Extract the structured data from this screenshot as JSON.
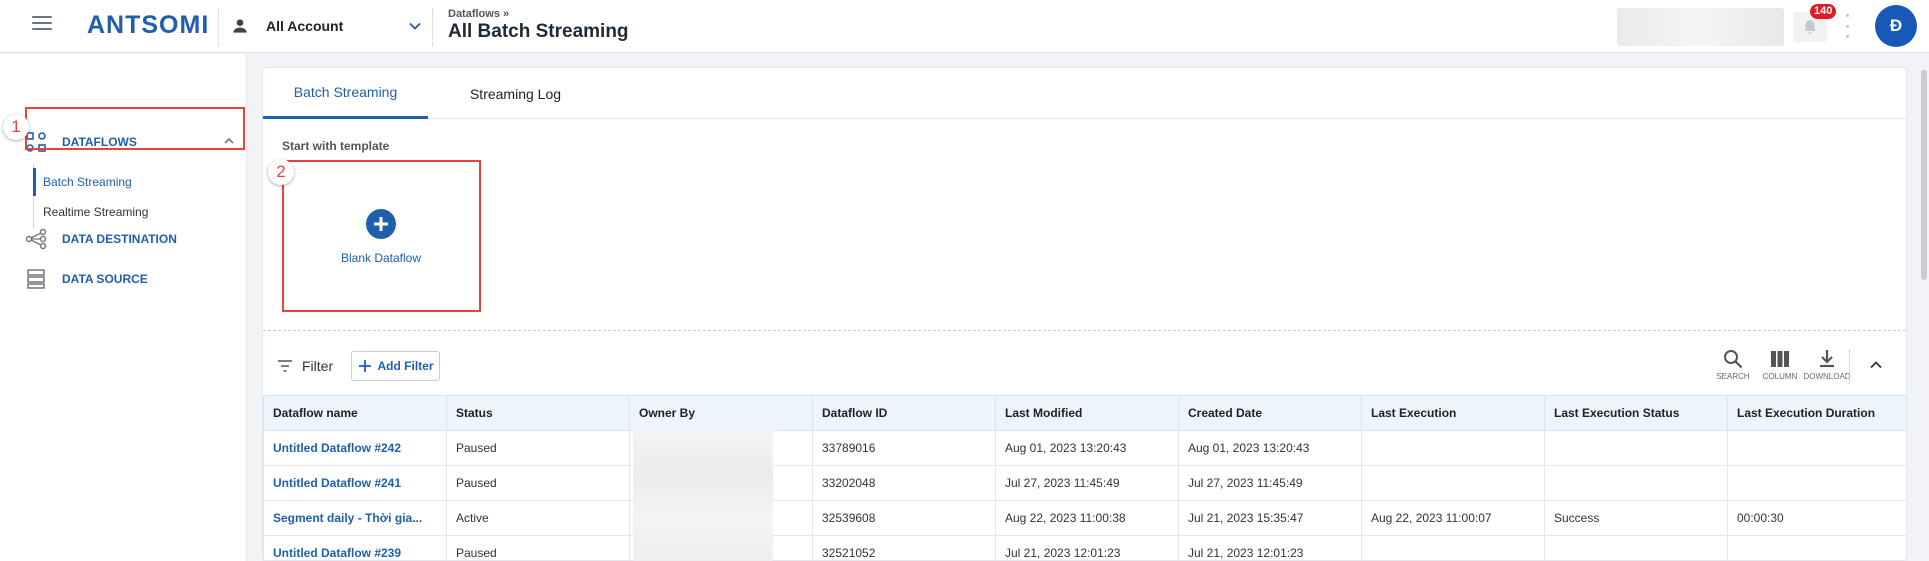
{
  "header": {
    "logo": "ANTSOMI",
    "account_label": "All Account",
    "breadcrumb_parent": "Dataflows »",
    "page_title": "All Batch Streaming",
    "notification_count": "140",
    "avatar_initial": "Đ"
  },
  "sidebar": {
    "dataflows_label": "DATAFLOWS",
    "sub_items": [
      "Batch Streaming",
      "Realtime Streaming"
    ],
    "destination_label": "DATA DESTINATION",
    "source_label": "DATA SOURCE"
  },
  "annotations": [
    "1",
    "2"
  ],
  "tabs": [
    "Batch Streaming",
    "Streaming Log"
  ],
  "templates": {
    "section_label": "Start with template",
    "blank_label": "Blank Dataflow"
  },
  "toolbar": {
    "filter_label": "Filter",
    "add_filter_label": "Add Filter",
    "search_label": "SEARCH",
    "column_label": "COLUMN",
    "download_label": "DOWNLOAD"
  },
  "table": {
    "columns": [
      "Dataflow name",
      "Status",
      "Owner By",
      "Dataflow ID",
      "Last Modified",
      "Created Date",
      "Last Execution",
      "Last Execution Status",
      "Last Execution Duration"
    ],
    "rows": [
      [
        "Untitled Dataflow #242",
        "Paused",
        "",
        "33789016",
        "Aug 01, 2023 13:20:43",
        "Aug 01, 2023 13:20:43",
        "",
        "",
        ""
      ],
      [
        "Untitled Dataflow #241",
        "Paused",
        "",
        "33202048",
        "Jul 27, 2023 11:45:49",
        "Jul 27, 2023 11:45:49",
        "",
        "",
        ""
      ],
      [
        "Segment daily - Thời gia...",
        "Active",
        "",
        "32539608",
        "Aug 22, 2023 11:00:38",
        "Jul 21, 2023 15:35:47",
        "Aug 22, 2023 11:00:07",
        "Success",
        "00:00:30"
      ],
      [
        "Untitled Dataflow #239",
        "Paused",
        "",
        "32521052",
        "Jul 21, 2023 12:01:23",
        "Jul 21, 2023 12:01:23",
        "",
        "",
        ""
      ]
    ]
  },
  "colors": {
    "brand": "#1f5fae",
    "annotation": "#e2453c",
    "badge": "#e01b24"
  }
}
